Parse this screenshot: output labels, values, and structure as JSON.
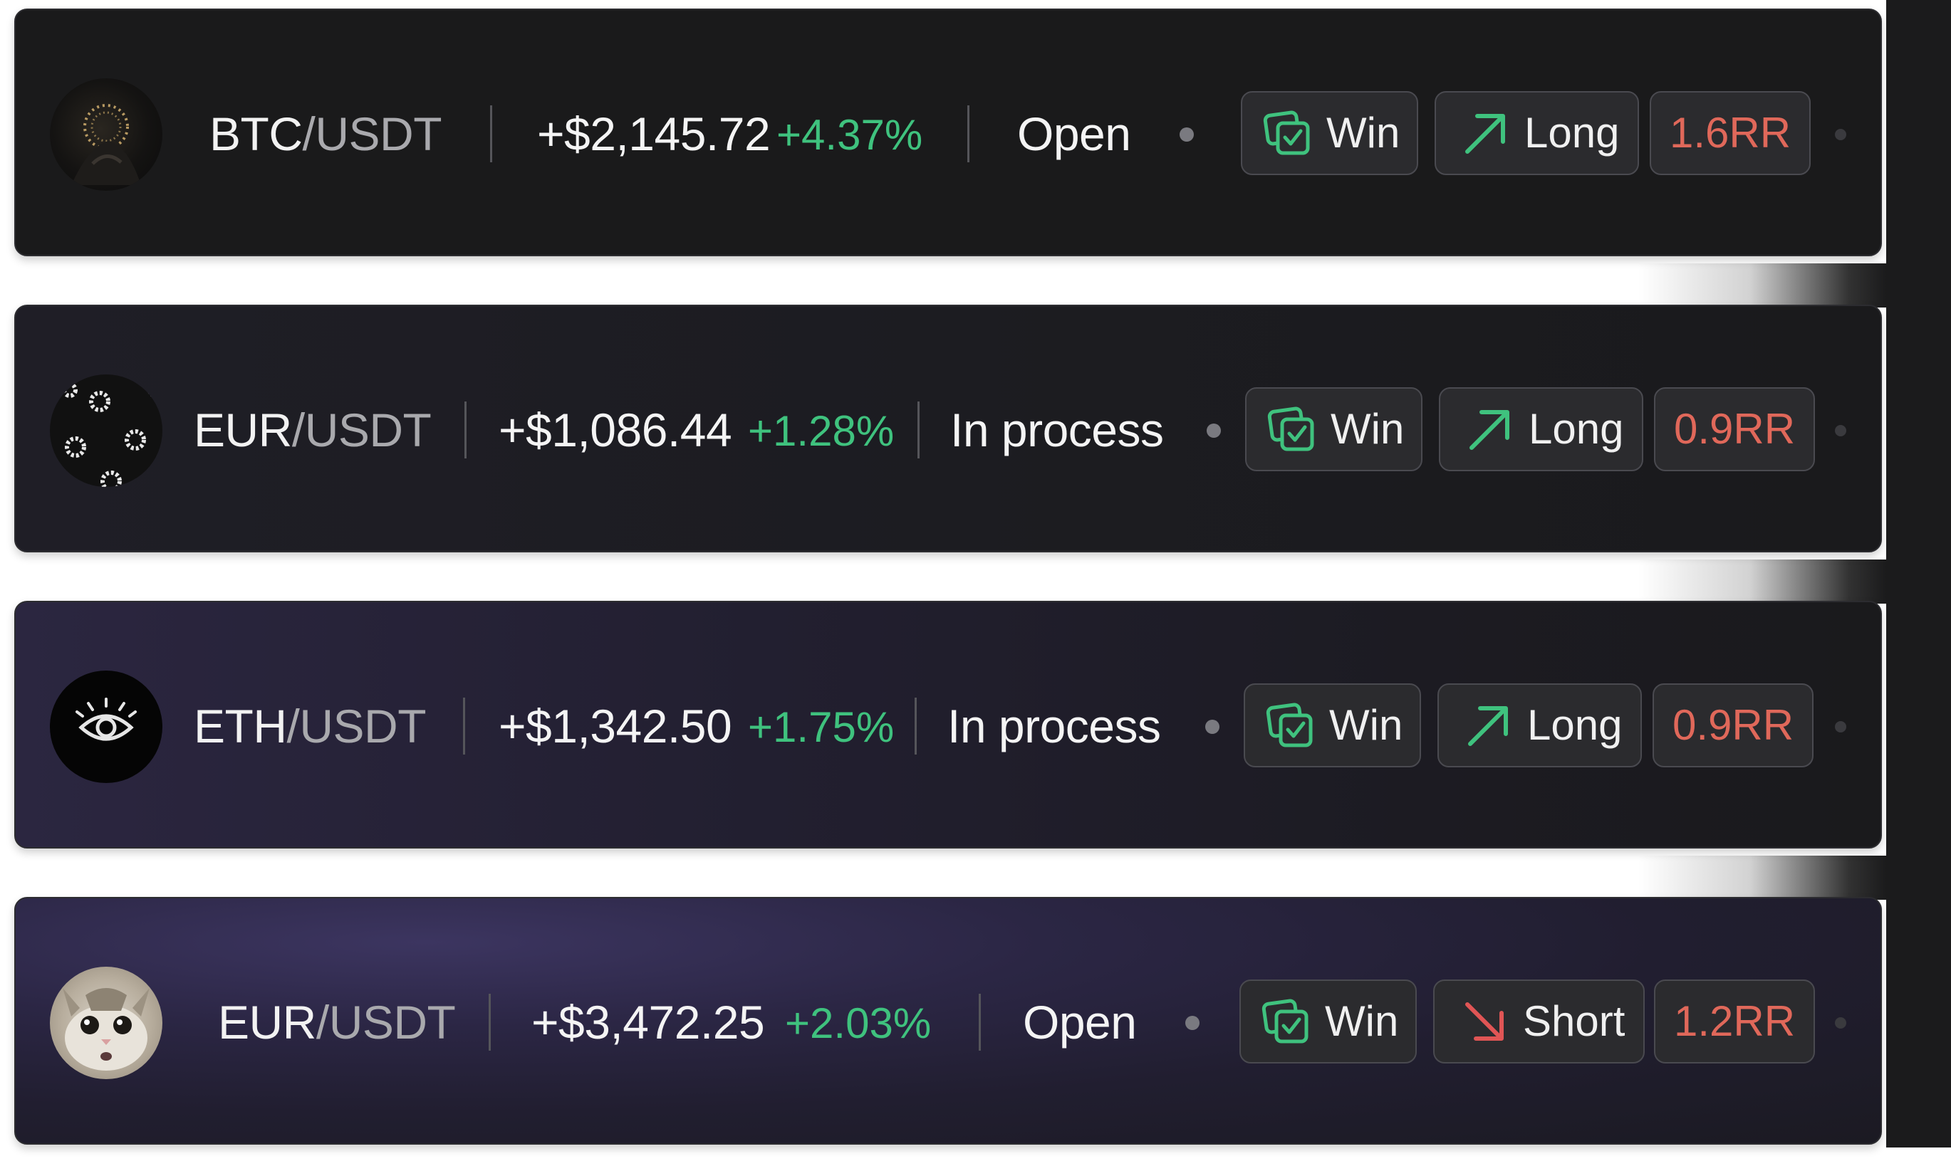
{
  "colors": {
    "profit_green": "#3fc27e",
    "rr_red": "#e0685a",
    "long_arrow_green": "#3fc27e",
    "short_arrow_red": "#e05555",
    "card_dark": "#1a1a1b",
    "card_purple": "#2b2644"
  },
  "trades": [
    {
      "avatar": "abstract-dark-sculpture-avatar",
      "base": "BTC",
      "slash": "/",
      "quote": "USDT",
      "pnl": "+$2,145.72",
      "pnl_pct": "+4.37%",
      "status": "Open",
      "result_icon": "win-checkbox-icon",
      "result": "Win",
      "direction_icon": "arrow-up-right-icon",
      "direction": "Long",
      "rr": "1.6RR"
    },
    {
      "avatar": "flower-pattern-avatar",
      "base": "EUR",
      "slash": "/",
      "quote": "USDT",
      "pnl": "+$1,086.44",
      "pnl_pct": "+1.28%",
      "status": "In process",
      "result_icon": "win-checkbox-icon",
      "result": "Win",
      "direction_icon": "arrow-up-right-icon",
      "direction": "Long",
      "rr": "0.9RR"
    },
    {
      "avatar": "eye-avatar",
      "base": "ETH",
      "slash": "/",
      "quote": "USDT",
      "pnl": "+$1,342.50",
      "pnl_pct": "+1.75%",
      "status": "In process",
      "result_icon": "win-checkbox-icon",
      "result": "Win",
      "direction_icon": "arrow-up-right-icon",
      "direction": "Long",
      "rr": "0.9RR"
    },
    {
      "avatar": "cat-face-avatar",
      "base": "EUR",
      "slash": "/",
      "quote": "USDT",
      "pnl": "+$3,472.25",
      "pnl_pct": "+2.03%",
      "status": "Open",
      "result_icon": "win-checkbox-icon",
      "result": "Win",
      "direction_icon": "arrow-down-right-icon",
      "direction": "Short",
      "rr": "1.2RR"
    }
  ]
}
